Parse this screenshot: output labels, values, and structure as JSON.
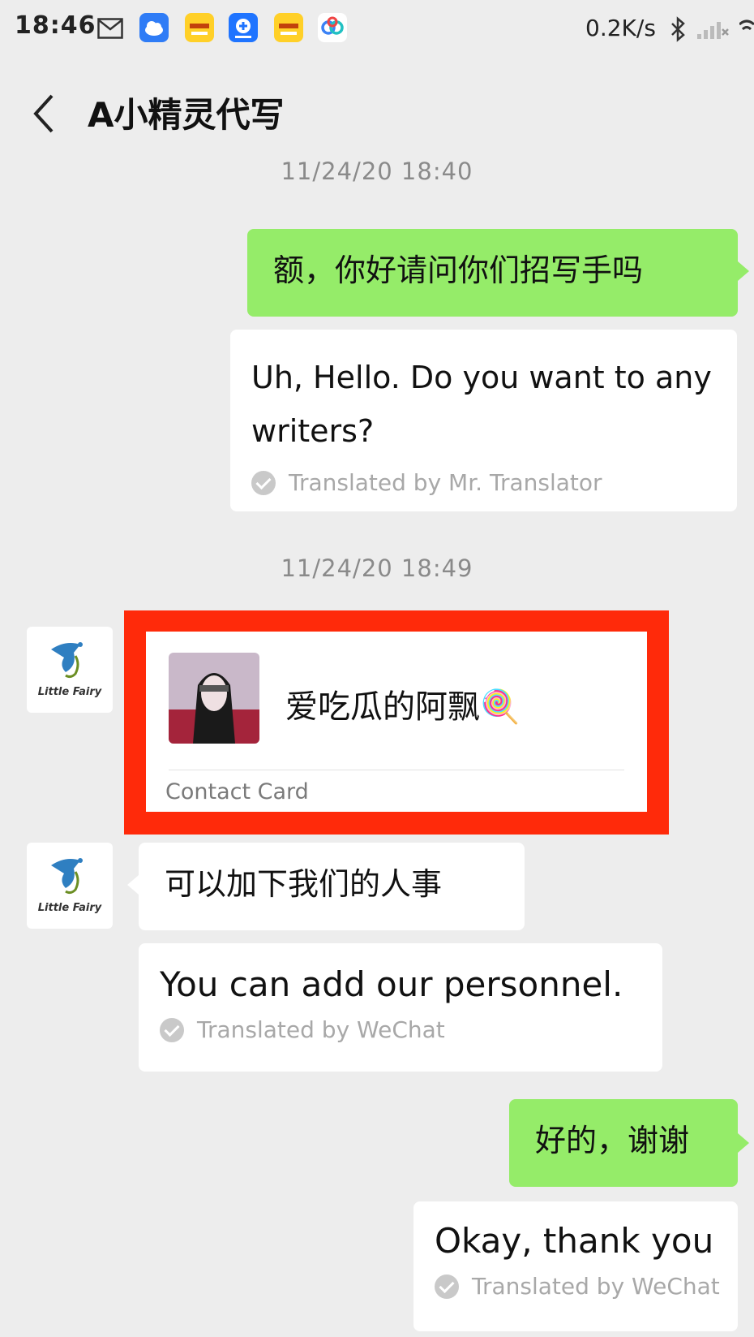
{
  "status_bar": {
    "time": "18:46",
    "net_speed": "0.2K/s",
    "icons": [
      "mail-icon",
      "cloud-app-icon",
      "shopping-app-icon",
      "video-app-icon",
      "shopping-app-icon",
      "sync-app-icon",
      "bluetooth-icon",
      "signal-icon",
      "wifi-icon"
    ]
  },
  "header": {
    "title": "A小精灵代写",
    "back_icon": "chevron-left-icon"
  },
  "messages": {
    "timestamp_1": "11/24/20 18:40",
    "msg1_text": "额，你好请问你们招写手吗",
    "msg1_translation": "Uh, Hello. Do you want to any writers?",
    "msg1_translator": "Translated by Mr. Translator",
    "timestamp_2": "11/24/20 18:49",
    "card_name": "爱吃瓜的阿飘🍭",
    "card_label": "Contact Card",
    "msg3_text": "可以加下我们的人事",
    "msg3_translation": "You can add our personnel.",
    "msg3_translator": "Translated by WeChat",
    "msg4_text": "好的，谢谢",
    "msg4_translation": "Okay, thank you",
    "msg4_translator": "Translated by WeChat",
    "avatar_label": "Little Fairy"
  },
  "colors": {
    "chat_bg": "#ededed",
    "self_bubble": "#95ec69",
    "other_bubble": "#ffffff",
    "highlight": "#ff2a0a"
  }
}
